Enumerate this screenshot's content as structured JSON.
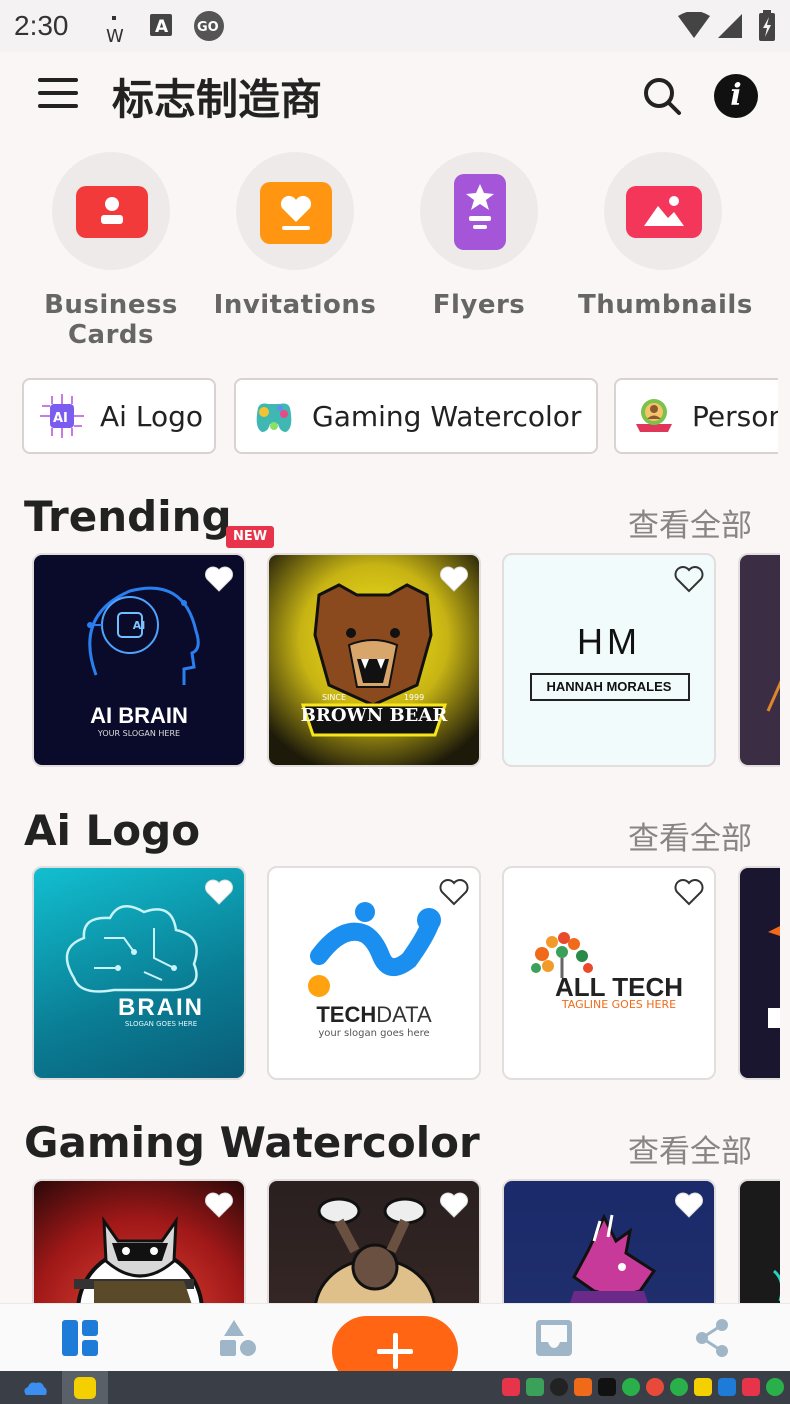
{
  "status_bar": {
    "time": "2:30"
  },
  "app_bar": {
    "title": "标志制造商"
  },
  "categories": [
    {
      "label": "Business Cards",
      "icon": "business-card-icon",
      "color": "#f23a3a"
    },
    {
      "label": "Invitations",
      "icon": "invitation-icon",
      "color": "#ff9510"
    },
    {
      "label": "Flyers",
      "icon": "flyer-icon",
      "color": "#a455d8"
    },
    {
      "label": "Thumbnails",
      "icon": "thumbnail-icon",
      "color": "#f4365a"
    }
  ],
  "chips": [
    {
      "label": "Ai Logo",
      "icon": "ai-chip-icon"
    },
    {
      "label": "Gaming Watercolor",
      "icon": "gamepad-icon"
    },
    {
      "label": "Personal",
      "icon": "person-badge-icon"
    }
  ],
  "sections": [
    {
      "title": "Trending",
      "badge": "NEW",
      "see_all": "查看全部",
      "cards": [
        {
          "name": "AI BRAIN",
          "tagline": "YOUR SLOGAN HERE",
          "chip_text": "AI"
        },
        {
          "name": "BROWN BEAR",
          "since": "SINCE",
          "year": "1999"
        },
        {
          "name": "HANNAH MORALES",
          "monogram": "HM"
        }
      ]
    },
    {
      "title": "Ai Logo",
      "see_all": "查看全部",
      "cards": [
        {
          "name": "BRAIN",
          "tagline": "SLOGAN GOES HERE"
        },
        {
          "name_a": "TECH",
          "name_b": "DATA",
          "tagline": "your slogan goes here"
        },
        {
          "name": "ALL TECH",
          "tagline": "TAGLINE GOES HERE"
        }
      ]
    },
    {
      "title": "Gaming Watercolor",
      "see_all": "查看全部",
      "cards": [
        {
          "name": "raccoon gunner mascot"
        },
        {
          "name": "gorilla lifter mascot"
        },
        {
          "name": "pink dragon mascot"
        }
      ]
    }
  ],
  "colors": {
    "accent": "#ff6512",
    "nav_active": "#1e7bd8",
    "new_badge": "#e8344a"
  }
}
